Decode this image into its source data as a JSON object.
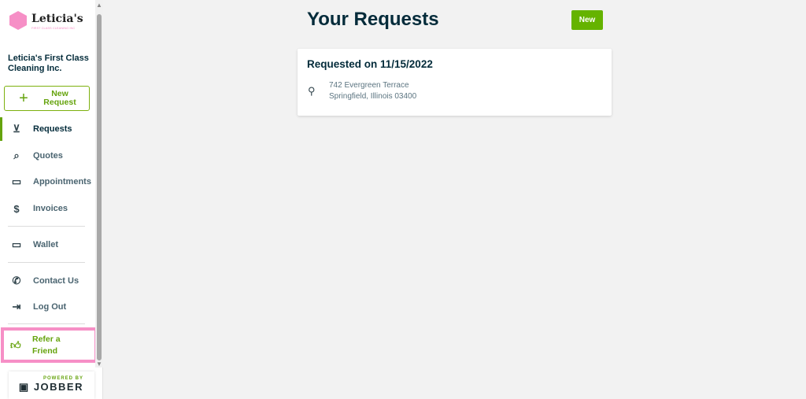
{
  "logo": {
    "name": "Leticia's",
    "tagline": "FIRST CLASS CLEANING INC"
  },
  "sidebar": {
    "company": "Leticia's First Class Cleaning Inc.",
    "new_request": "New Request",
    "items": [
      {
        "label": "Requests",
        "icon": "inbox-download-icon",
        "active": true
      },
      {
        "label": "Quotes",
        "icon": "quote-search-icon"
      },
      {
        "label": "Appointments",
        "icon": "calendar-icon"
      },
      {
        "label": "Invoices",
        "icon": "invoice-dollar-icon"
      },
      {
        "label": "Wallet",
        "icon": "wallet-icon"
      },
      {
        "label": "Contact Us",
        "icon": "phone-icon"
      },
      {
        "label": "Log Out",
        "icon": "logout-icon"
      }
    ],
    "refer": "Refer a Friend",
    "powered_by": "POWERED BY",
    "jobber": "JOBBER"
  },
  "main": {
    "title": "Your Requests",
    "new_label": "New",
    "requests": [
      {
        "title": "Requested on 11/15/2022",
        "address_line1": "742 Evergreen Terrace",
        "address_line2": "Springfield, Illinois 03400"
      }
    ]
  },
  "colors": {
    "accent": "#65a30d",
    "highlight": "#f68fc6",
    "heading": "#032b3a"
  }
}
